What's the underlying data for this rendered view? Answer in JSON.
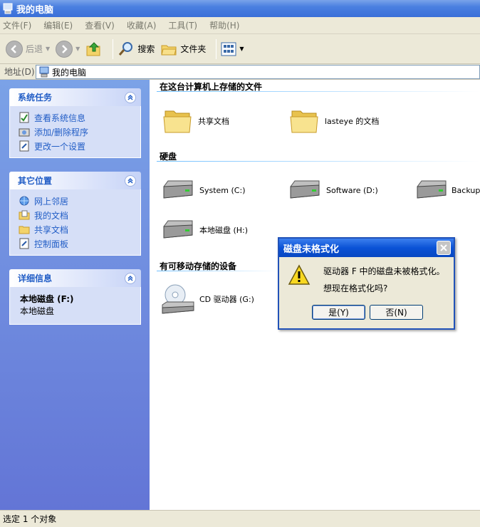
{
  "window": {
    "title": "我的电脑"
  },
  "menu": [
    {
      "label": "文件(F)"
    },
    {
      "label": "编辑(E)"
    },
    {
      "label": "查看(V)"
    },
    {
      "label": "收藏(A)"
    },
    {
      "label": "工具(T)"
    },
    {
      "label": "帮助(H)"
    }
  ],
  "toolbar": {
    "back": "后退",
    "search": "搜索",
    "folders": "文件夹"
  },
  "address": {
    "label": "地址(D)",
    "value": "我的电脑"
  },
  "sidebar": {
    "system_tasks": {
      "title": "系统任务",
      "items": [
        {
          "label": "查看系统信息"
        },
        {
          "label": "添加/删除程序"
        },
        {
          "label": "更改一个设置"
        }
      ]
    },
    "other_places": {
      "title": "其它位置",
      "items": [
        {
          "label": "网上邻居"
        },
        {
          "label": "我的文档"
        },
        {
          "label": "共享文档"
        },
        {
          "label": "控制面板"
        }
      ]
    },
    "details": {
      "title": "详细信息",
      "name": "本地磁盘 (F:)",
      "type": "本地磁盘"
    }
  },
  "main": {
    "files_section": "在这台计算机上存储的文件",
    "files": [
      {
        "label": "共享文档"
      },
      {
        "label": "lasteye 的文档"
      }
    ],
    "drives_section": "硬盘",
    "drives": [
      {
        "label": "System (C:)"
      },
      {
        "label": "Software (D:)"
      },
      {
        "label": "Backup"
      },
      {
        "label": "本地磁盘 (H:)"
      }
    ],
    "removable_section": "有可移动存储的设备",
    "removable": [
      {
        "label": "CD 驱动器 (G:)"
      }
    ]
  },
  "status": {
    "text": "选定 1 个对象"
  },
  "dialog": {
    "title": "磁盘未格式化",
    "line1": "驱动器 F 中的磁盘未被格式化。",
    "line2": "想现在格式化吗?",
    "yes": "是(Y)",
    "no": "否(N)"
  },
  "colors": {
    "title_bar": "#3a6fd8",
    "sidebar_link": "#215dc6",
    "dialog_title": "#0a52d6"
  }
}
